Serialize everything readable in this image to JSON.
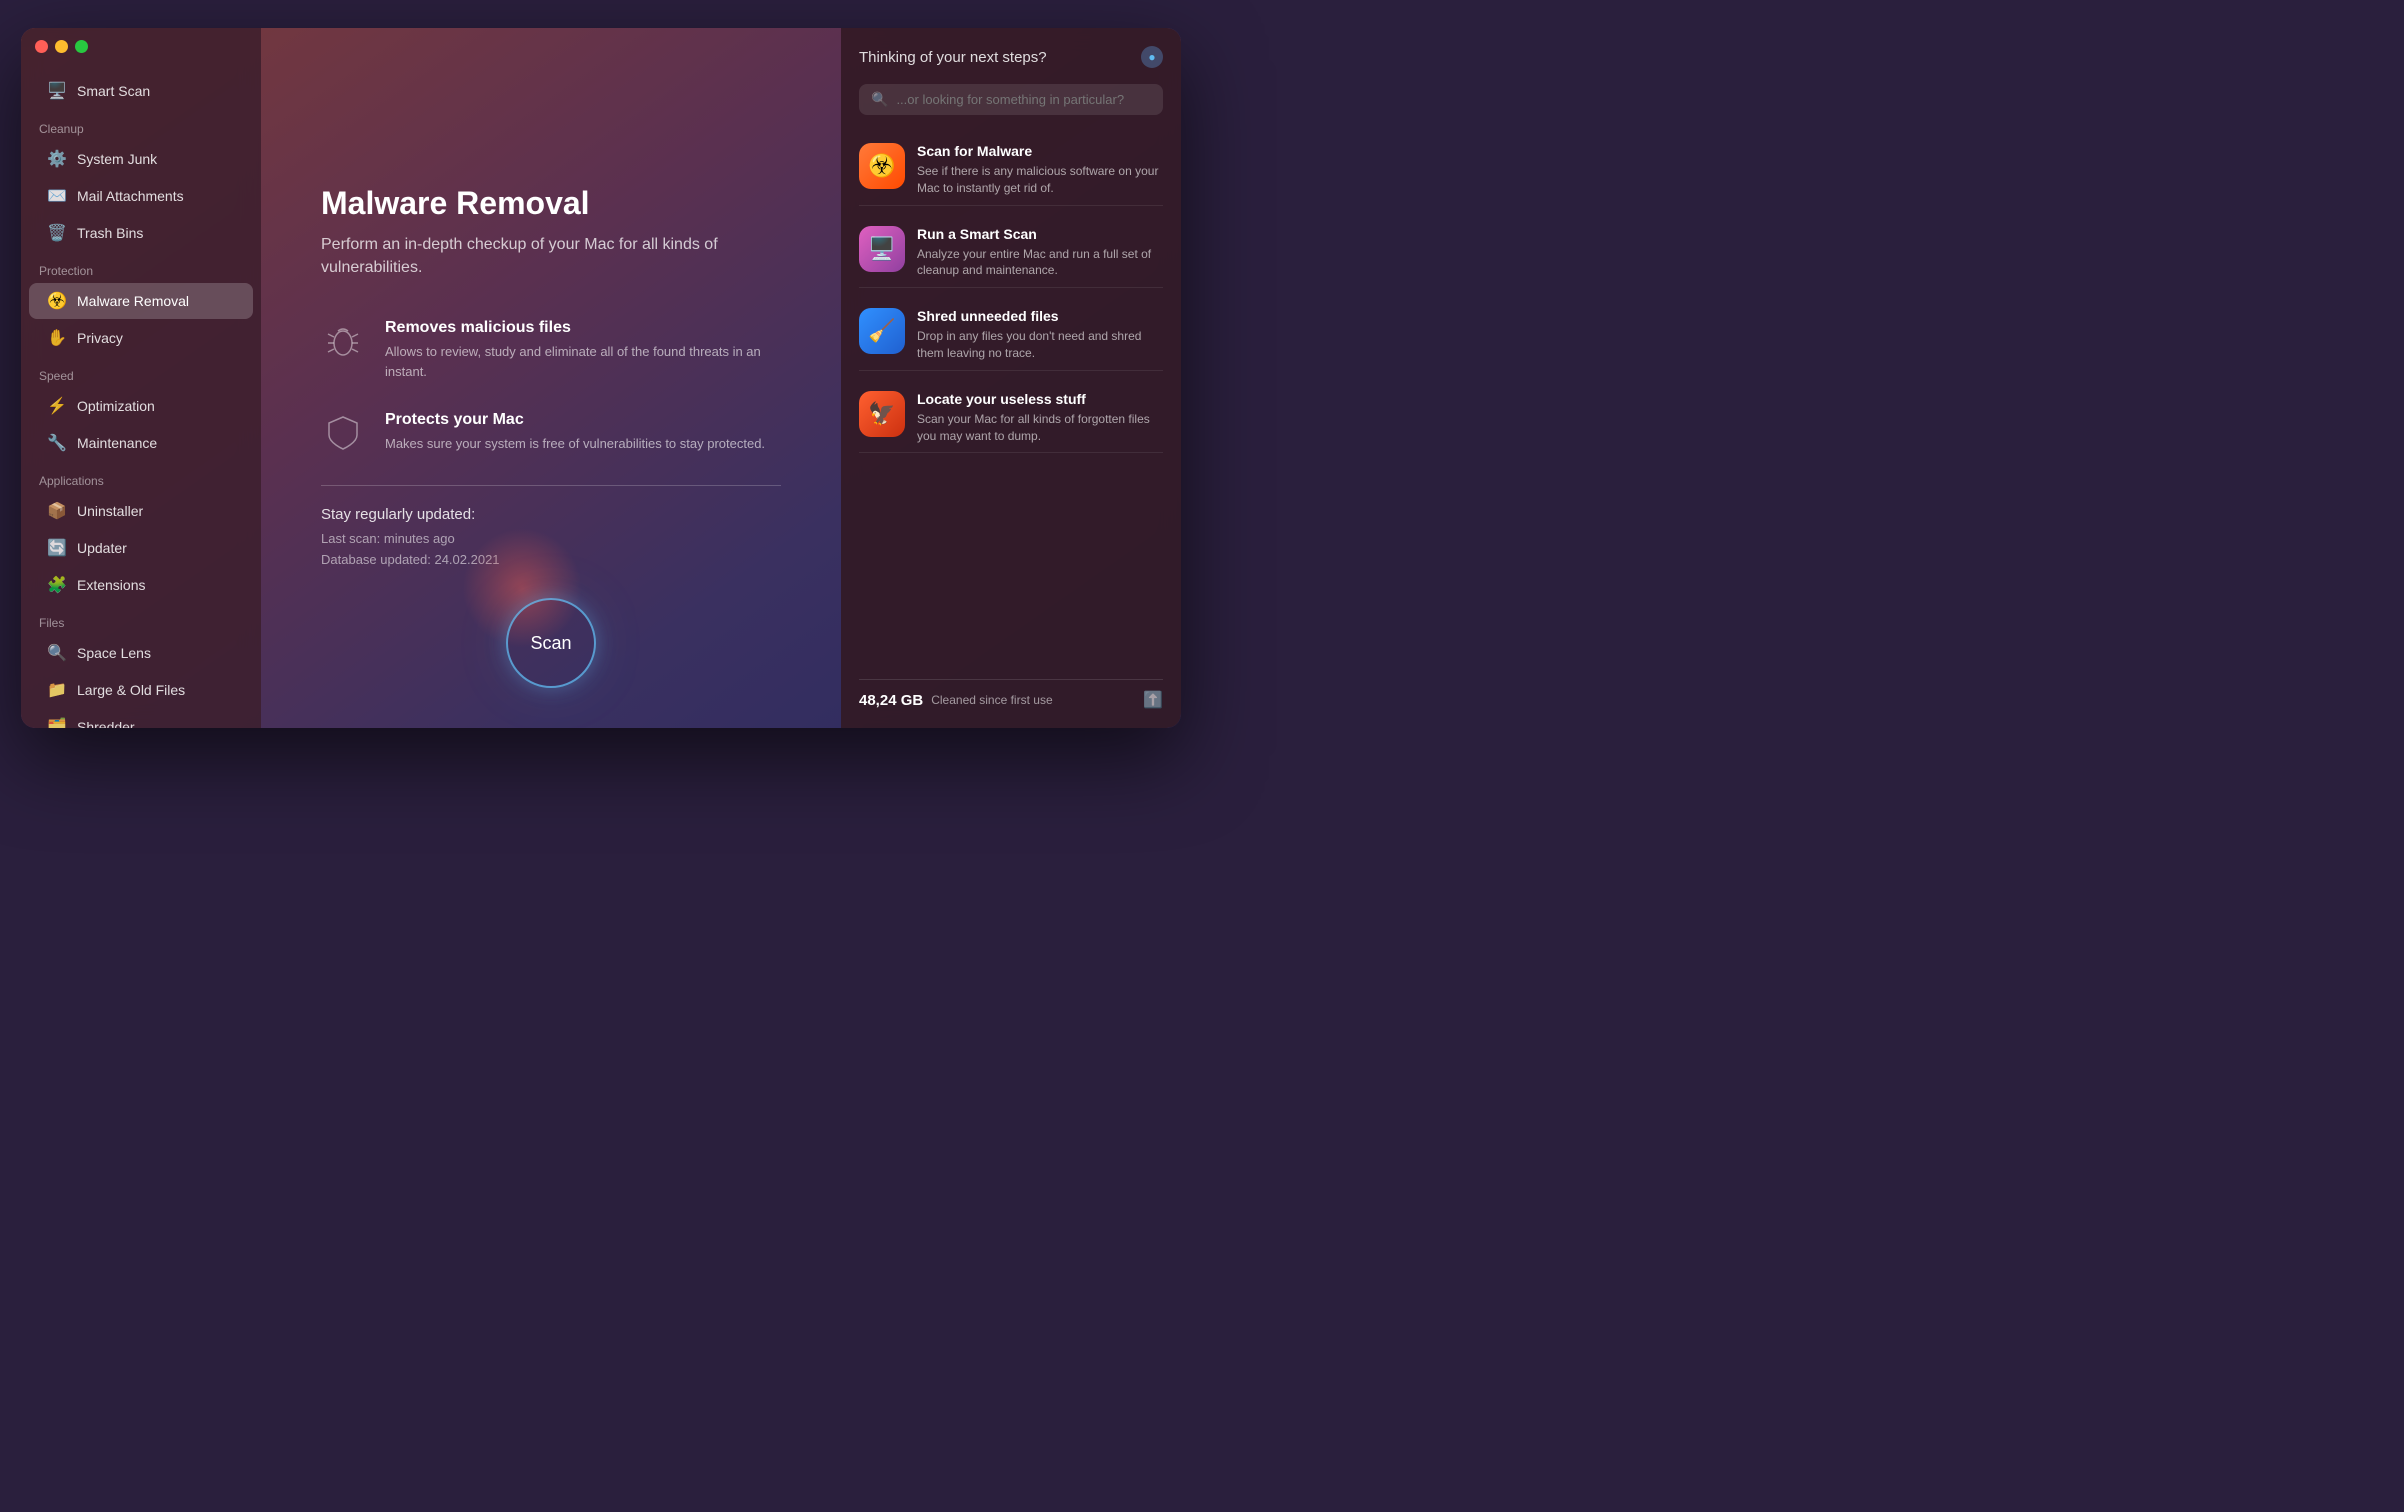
{
  "window": {
    "traffic_lights": [
      "close",
      "minimize",
      "maximize"
    ]
  },
  "sidebar": {
    "smart_scan_label": "Smart Scan",
    "cleanup_section": "Cleanup",
    "cleanup_items": [
      {
        "label": "System Junk",
        "icon": "⚙️"
      },
      {
        "label": "Mail Attachments",
        "icon": "✉️"
      },
      {
        "label": "Trash Bins",
        "icon": "🗑️"
      }
    ],
    "protection_section": "Protection",
    "protection_items": [
      {
        "label": "Malware Removal",
        "icon": "🦠",
        "active": true
      },
      {
        "label": "Privacy",
        "icon": "✋"
      }
    ],
    "speed_section": "Speed",
    "speed_items": [
      {
        "label": "Optimization",
        "icon": "⚡"
      },
      {
        "label": "Maintenance",
        "icon": "🔧"
      }
    ],
    "applications_section": "Applications",
    "applications_items": [
      {
        "label": "Uninstaller",
        "icon": "📦"
      },
      {
        "label": "Updater",
        "icon": "🔄"
      },
      {
        "label": "Extensions",
        "icon": "🧩"
      }
    ],
    "files_section": "Files",
    "files_items": [
      {
        "label": "Space Lens",
        "icon": "🔍"
      },
      {
        "label": "Large & Old Files",
        "icon": "📁"
      },
      {
        "label": "Shredder",
        "icon": "🗂️"
      }
    ]
  },
  "main": {
    "title": "Malware Removal",
    "subtitle": "Perform an in-depth checkup of your Mac for all kinds of vulnerabilities.",
    "features": [
      {
        "title": "Removes malicious files",
        "desc": "Allows to review, study and eliminate all of the found threats in an instant."
      },
      {
        "title": "Protects your Mac",
        "desc": "Makes sure your system is free of vulnerabilities to stay protected."
      }
    ],
    "stay_updated_title": "Stay regularly updated:",
    "last_scan_label": "Last scan: minutes ago",
    "db_updated_label": "Database updated: 24.02.2021",
    "scan_button_label": "Scan"
  },
  "panel": {
    "title": "Thinking of your next steps?",
    "search_placeholder": "...or looking for something in particular?",
    "suggestions": [
      {
        "title": "Scan for Malware",
        "desc": "See if there is any malicious software on your Mac to instantly get rid of.",
        "icon_type": "malware",
        "icon": "☣️"
      },
      {
        "title": "Run a Smart Scan",
        "desc": "Analyze your entire Mac and run a full set of cleanup and maintenance.",
        "icon_type": "smart",
        "icon": "🖥️"
      },
      {
        "title": "Shred unneeded files",
        "desc": "Drop in any files you don't need and shred them leaving no trace.",
        "icon_type": "shred",
        "icon": "🧹"
      },
      {
        "title": "Locate your useless stuff",
        "desc": "Scan your Mac for all kinds of forgotten files you may want to dump.",
        "icon_type": "locate",
        "icon": "🦅"
      }
    ],
    "cleaned_gb": "48,24 GB",
    "cleaned_label": "Cleaned since first use"
  }
}
